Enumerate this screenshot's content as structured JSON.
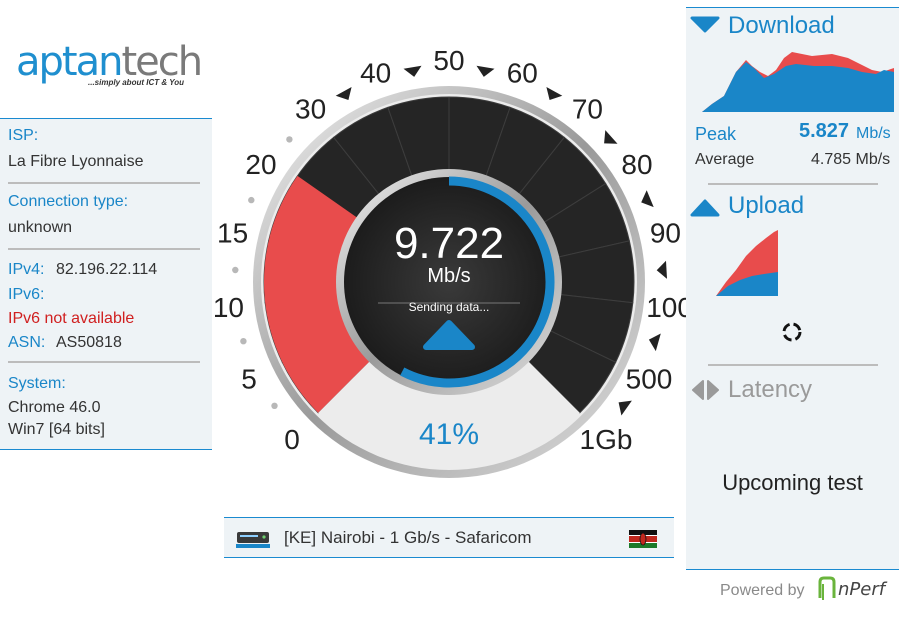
{
  "logo": {
    "brand_part1": "aptan",
    "brand_part2": "tech",
    "tagline": "...simply about ICT & You"
  },
  "connection": {
    "isp_label": "ISP:",
    "isp_value": "La Fibre Lyonnaise",
    "type_label": "Connection type:",
    "type_value": "unknown",
    "ipv4_label": "IPv4:",
    "ipv4_value": "82.196.22.114",
    "ipv6_label": "IPv6:",
    "ipv6_value": "IPv6 not available",
    "asn_label": "ASN:",
    "asn_value": "AS50818",
    "system_label": "System:",
    "browser": "Chrome 46.0",
    "os": "Win7 [64 bits]"
  },
  "gauge": {
    "speed": "9.722",
    "speed_unit": "Mb/s",
    "status": "Sending data...",
    "progress_percent_label": "41%",
    "progress_fraction": 0.41,
    "arc_fraction": 0.78,
    "scale_labels": [
      "0",
      "5",
      "10",
      "15",
      "20",
      "30",
      "40",
      "50",
      "60",
      "70",
      "80",
      "90",
      "100",
      "500",
      "1Gb"
    ]
  },
  "server": {
    "label": "[KE] Nairobi - 1 Gb/s - Safaricom",
    "icon": "server-icon",
    "flag": "kenya-flag"
  },
  "download": {
    "title": "Download",
    "peak_label": "Peak",
    "peak_value": "5.827",
    "peak_unit": "Mb/s",
    "average_label": "Average",
    "average_value": "4.785 Mb/s"
  },
  "upload": {
    "title": "Upload",
    "spinner": "loading-icon"
  },
  "latency": {
    "title": "Latency"
  },
  "upcoming_text": "Upcoming test",
  "footer": {
    "powered_by": "Powered by",
    "brand": "nPerf"
  },
  "colors": {
    "accent": "#1a86c8",
    "red": "#e84c4c",
    "dark": "#2a2a2a",
    "panel": "#eef3f6"
  }
}
